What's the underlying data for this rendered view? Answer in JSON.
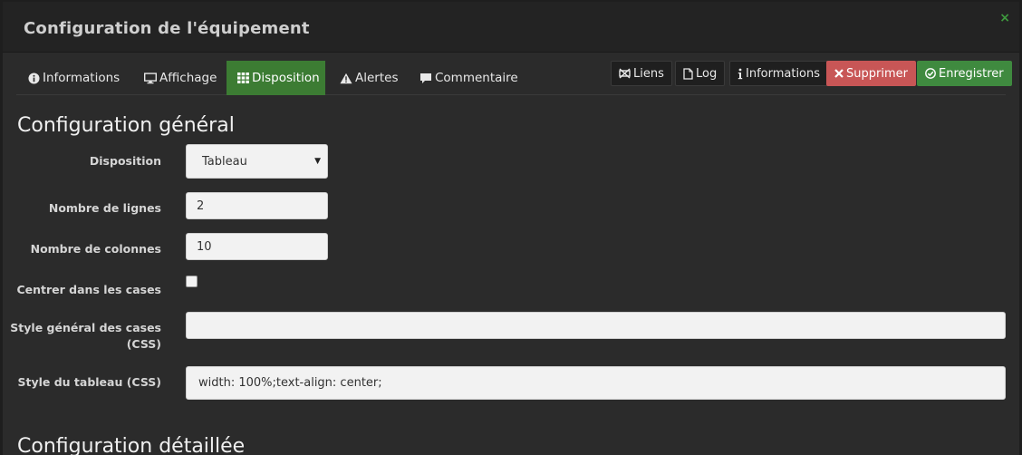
{
  "window": {
    "title": "Configuration de l'équipement",
    "close_symbol": "×"
  },
  "tabs": [
    {
      "label": "Informations",
      "icon": "info-circle-icon"
    },
    {
      "label": "Affichage",
      "icon": "desktop-icon"
    },
    {
      "label": "Disposition",
      "icon": "grid-icon",
      "active": true
    },
    {
      "label": "Alertes",
      "icon": "warning-icon"
    },
    {
      "label": "Commentaire",
      "icon": "comment-icon"
    }
  ],
  "actions": {
    "liens": "Liens",
    "log": "Log",
    "informations": "Informations",
    "supprimer": "Supprimer",
    "enregistrer": "Enregistrer"
  },
  "sections": {
    "general": "Configuration général",
    "detailed": "Configuration détaillée"
  },
  "form": {
    "disposition": {
      "label": "Disposition",
      "value": "Tableau"
    },
    "lines": {
      "label": "Nombre de lignes",
      "value": "2"
    },
    "columns": {
      "label": "Nombre de colonnes",
      "value": "10"
    },
    "center": {
      "label": "Centrer dans les cases",
      "checked": false
    },
    "cell_style": {
      "label_line1": "Style général des cases",
      "label_line2": "(CSS)",
      "value": ""
    },
    "table_style": {
      "label": "Style du tableau (CSS)",
      "value": "width: 100%;text-align: center;"
    }
  },
  "colors": {
    "active_tab": "#3c7c33",
    "danger": "#c85656",
    "success": "#3f8a3f",
    "background": "#2b2b2b"
  }
}
